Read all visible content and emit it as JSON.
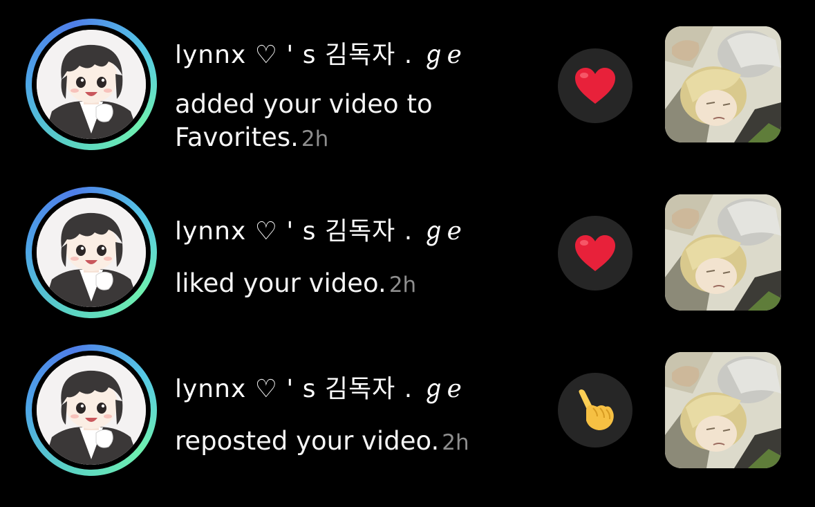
{
  "notifications": [
    {
      "username": "lynnx ♡ ' s  김독자  . ℊℯ",
      "action": "added your video to Favorites.",
      "time": "2h",
      "badge_icon": "heart-icon"
    },
    {
      "username": "lynnx ♡ ' s  김독자  . ℊℯ",
      "action": "liked your video.",
      "time": "2h",
      "badge_icon": "heart-icon"
    },
    {
      "username": "lynnx ♡ ' s  김독자  . ℊℯ",
      "action": "reposted your video.",
      "time": "2h",
      "badge_icon": "pointing-hand-icon"
    }
  ],
  "colors": {
    "background": "#000000",
    "badge_background": "#262626",
    "heart": "#e8213a",
    "time_text": "#8e8e8e",
    "ring_gradient": [
      "#4f7ee8",
      "#6ff0b0"
    ]
  }
}
